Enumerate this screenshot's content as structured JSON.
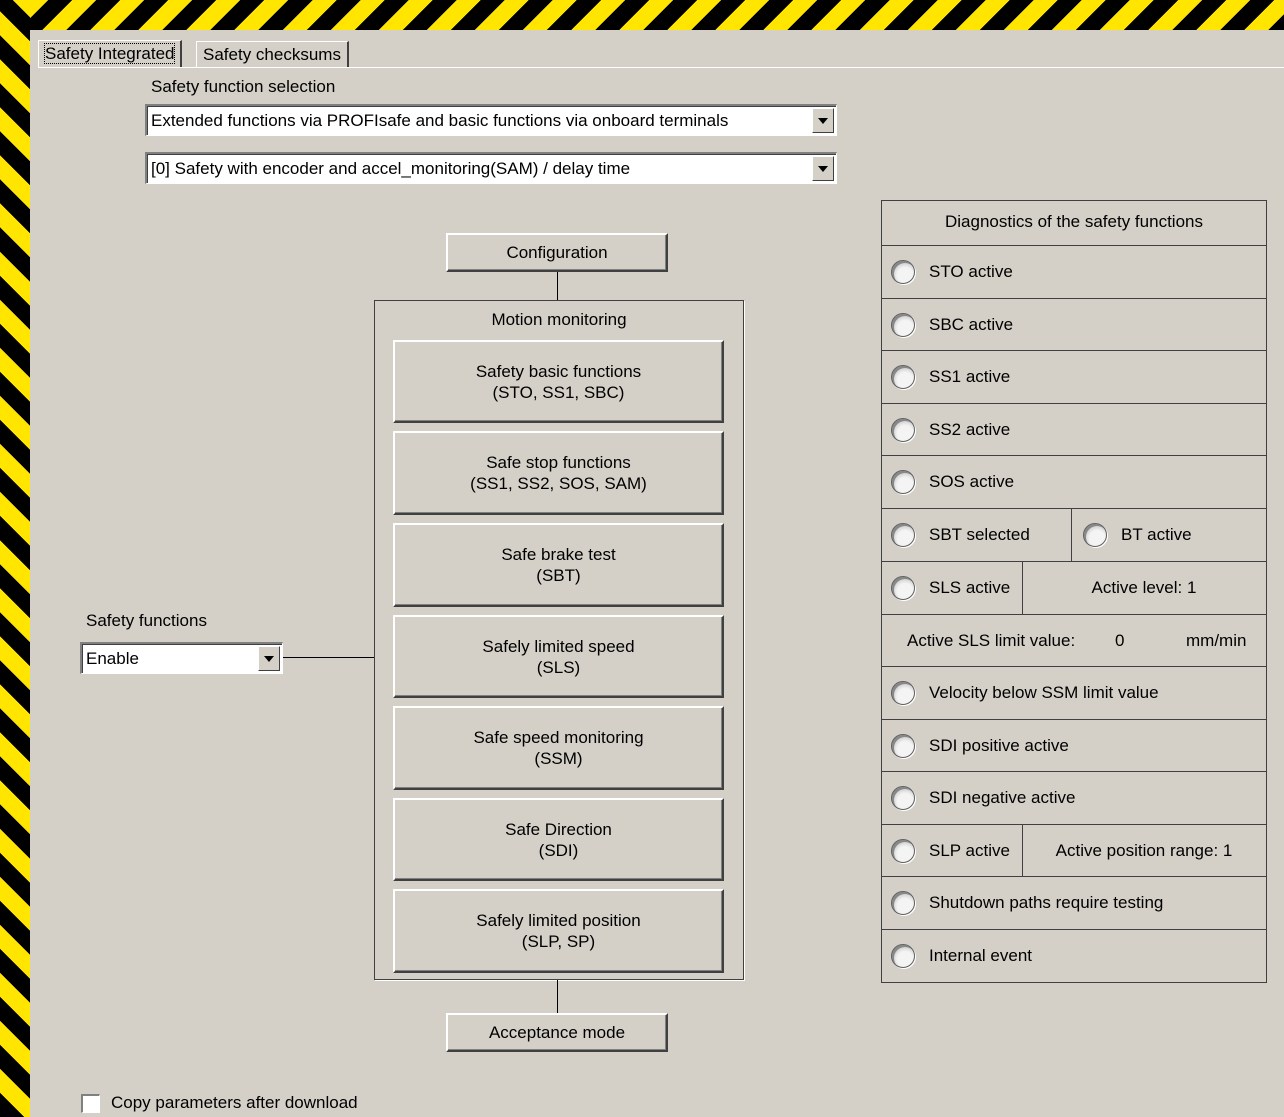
{
  "tabs": [
    "Safety Integrated",
    "Safety checksums"
  ],
  "selection": {
    "label": "Safety function selection",
    "combo1_value": "Extended functions via PROFIsafe and basic functions via onboard terminals",
    "combo2_value": "[0] Safety with encoder and accel_monitoring(SAM) / delay time"
  },
  "safety_functions": {
    "label": "Safety functions",
    "value": "Enable"
  },
  "flow": {
    "configuration": "Configuration",
    "motion_title": "Motion monitoring",
    "acceptance": "Acceptance mode",
    "buttons": [
      {
        "line1": "Safety basic functions",
        "line2": "(STO, SS1, SBC)"
      },
      {
        "line1": "Safe stop functions",
        "line2": "(SS1, SS2, SOS, SAM)"
      },
      {
        "line1": "Safe brake test",
        "line2": "(SBT)"
      },
      {
        "line1": "Safely limited speed",
        "line2": "(SLS)"
      },
      {
        "line1": "Safe speed monitoring",
        "line2": "(SSM)"
      },
      {
        "line1": "Safe Direction",
        "line2": "(SDI)"
      },
      {
        "line1": "Safely limited position",
        "line2": "(SLP, SP)"
      }
    ]
  },
  "diagnostics": {
    "title": "Diagnostics of the safety functions",
    "sto": "STO active",
    "sbc": "SBC active",
    "ss1": "SS1 active",
    "ss2": "SS2 active",
    "sos": "SOS active",
    "sbt": "SBT selected",
    "bt": "BT active",
    "sls": "SLS active",
    "active_level": "Active level:  1",
    "sls_limit_label": "Active SLS limit value:",
    "sls_limit_value": "0",
    "sls_limit_unit": "mm/min",
    "ssm": "Velocity below SSM limit value",
    "sdi_pos": "SDI positive active",
    "sdi_neg": "SDI negative active",
    "slp": "SLP active",
    "position_range": "Active position range:  1",
    "shutdown": "Shutdown paths require testing",
    "internal": "Internal event"
  },
  "copy_params": {
    "label": "Copy parameters after download",
    "checked": false
  }
}
